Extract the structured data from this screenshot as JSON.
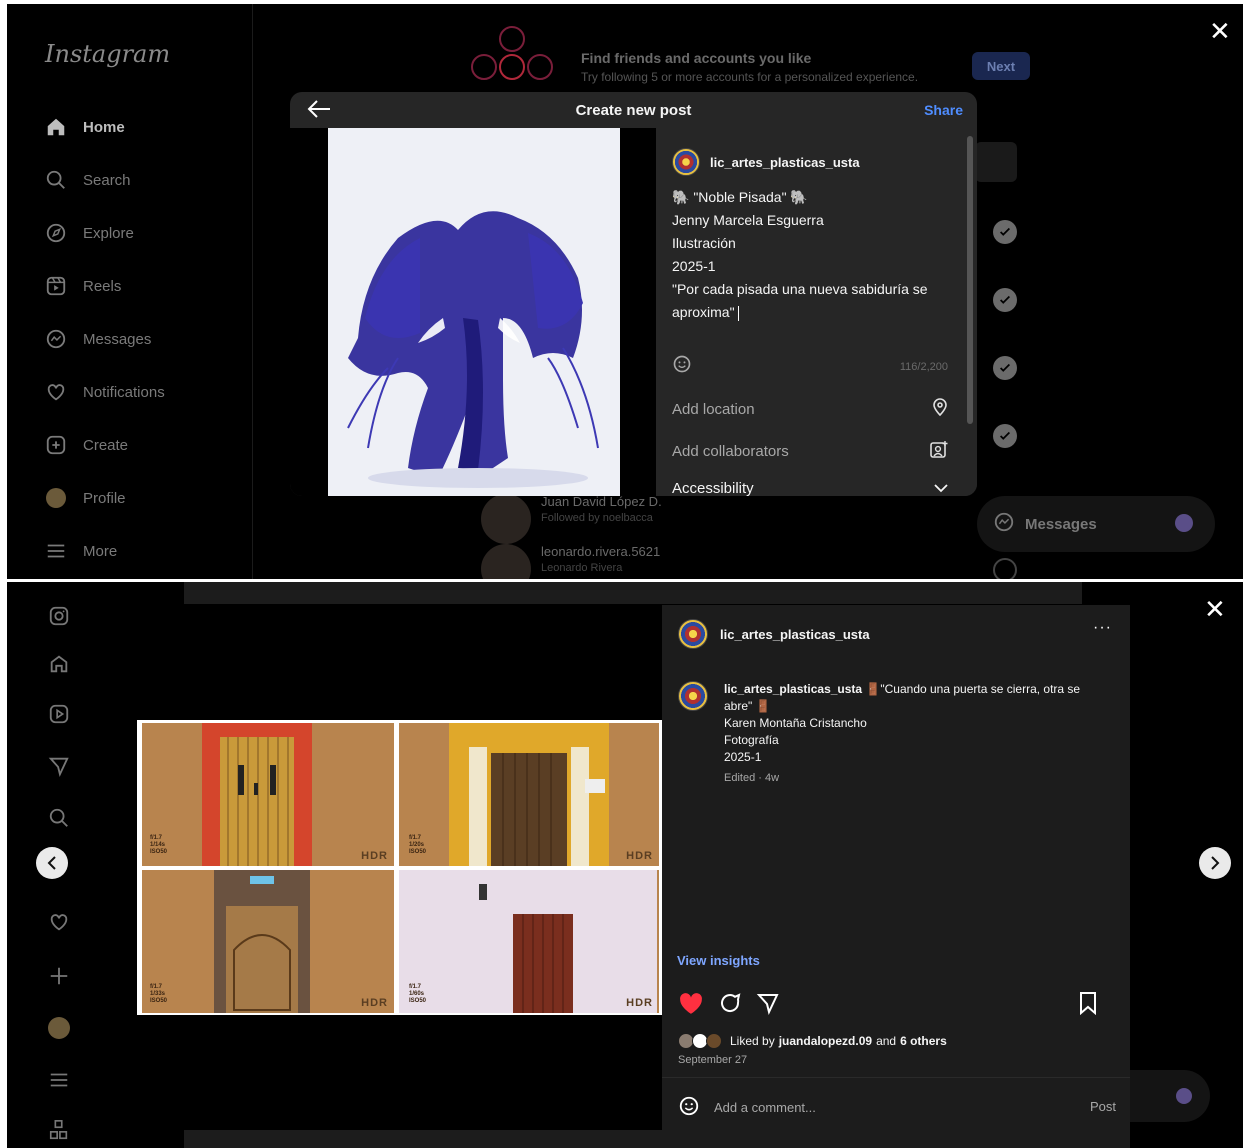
{
  "top": {
    "logo": "Instagram",
    "nav": [
      {
        "label": "Home",
        "icon": "home-icon"
      },
      {
        "label": "Search",
        "icon": "search-icon"
      },
      {
        "label": "Explore",
        "icon": "explore-icon"
      },
      {
        "label": "Reels",
        "icon": "reels-icon"
      },
      {
        "label": "Messages",
        "icon": "messages-icon"
      },
      {
        "label": "Notifications",
        "icon": "heart-icon"
      },
      {
        "label": "Create",
        "icon": "create-icon"
      },
      {
        "label": "Profile",
        "icon": "avatar"
      },
      {
        "label": "More",
        "icon": "menu-icon"
      }
    ],
    "banner": {
      "title": "Find friends and accounts you like",
      "subtitle": "Try following 5 or more accounts for a personalized experience.",
      "next_label": "Next"
    },
    "suggestions": [
      {
        "name": "Juan David López D.",
        "sub": "Followed by noelbacca"
      },
      {
        "name": "leonardo.rivera.5621",
        "sub": "Leonardo Rivera"
      }
    ],
    "messages_pill": "Messages",
    "close": "✕"
  },
  "create_modal": {
    "title": "Create new post",
    "share_label": "Share",
    "username": "lic_artes_plasticas_usta",
    "caption_lines": [
      "🐘 \"Noble Pisada\" 🐘",
      "Jenny Marcela Esguerra",
      "Ilustración",
      "2025-1",
      "\"Por cada pisada una nueva sabiduría se",
      "aproxima\""
    ],
    "char_count": "116/2,200",
    "add_location": "Add location",
    "add_collaborators": "Add collaborators",
    "accessibility": "Accessibility"
  },
  "post_view": {
    "username": "lic_artes_plasticas_usta",
    "more": "···",
    "caption_user": "lic_artes_plasticas_usta",
    "caption_lines": [
      "🚪\"Cuando una puerta se cierra, otra se abre\" 🚪",
      "Karen Montaña Cristancho",
      "Fotografía",
      "2025-1"
    ],
    "edited": "Edited · 4w",
    "insights": "View insights",
    "liked_prefix": "Liked by",
    "liked_user": "juandalopezd.09",
    "liked_and": "and",
    "liked_others": "6 others",
    "date": "September 27",
    "comment_placeholder": "Add a comment...",
    "post_label": "Post",
    "close": "✕",
    "tiles": [
      {
        "label": "f/1.7\n1/14s\nISO50",
        "tag": "HDR"
      },
      {
        "label": "f/1.7\n1/20s\nISO50",
        "tag": "HDR"
      },
      {
        "label": "f/1.7\n1/33s\nISO50",
        "tag": "HDR"
      },
      {
        "label": "f/1.7\n1/60s\nISO50",
        "tag": "HDR"
      }
    ]
  },
  "colors": {
    "accent_blue": "#4f8dff",
    "like_red": "#ff3040",
    "panel_bg": "#262626"
  }
}
